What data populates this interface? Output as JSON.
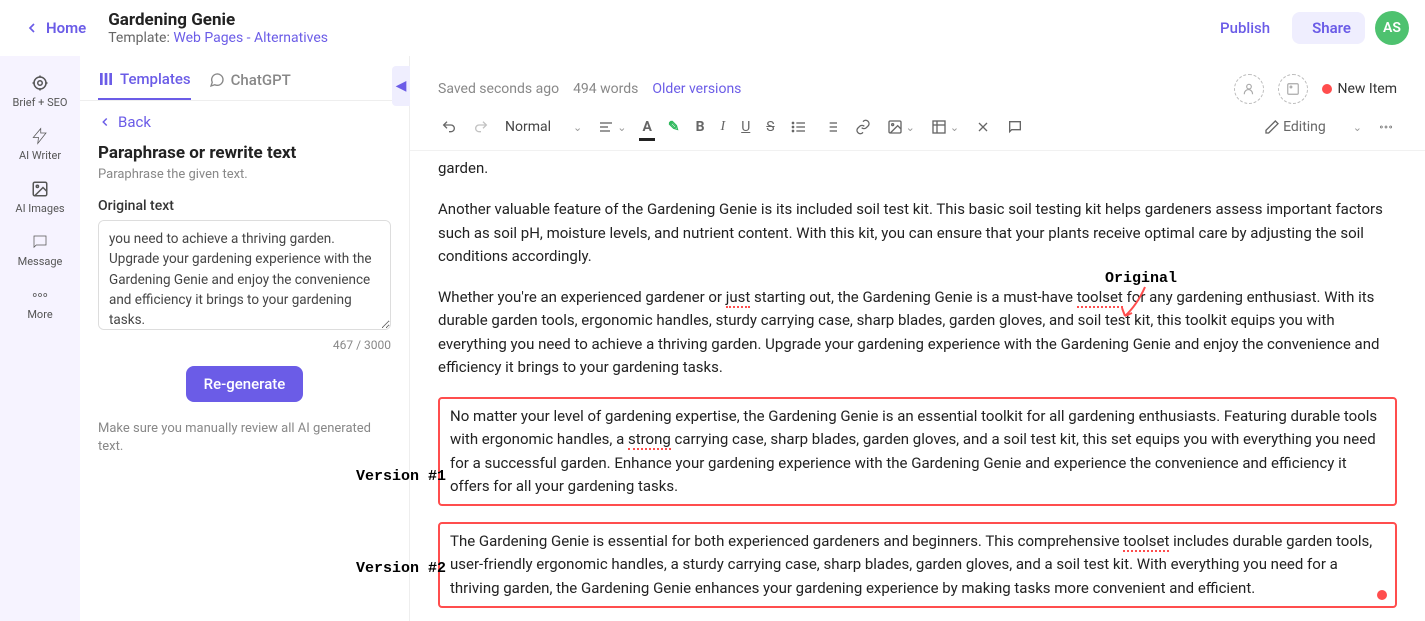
{
  "header": {
    "home": "Home",
    "title": "Gardening Genie",
    "template_prefix": "Template: ",
    "template_name": "Web Pages - Alternatives",
    "publish": "Publish",
    "share": "Share",
    "avatar": "AS"
  },
  "rail": {
    "brief": "Brief + SEO",
    "writer": "AI Writer",
    "images": "AI Images",
    "message": "Message",
    "more": "More"
  },
  "panel": {
    "tab_templates": "Templates",
    "tab_chatgpt": "ChatGPT",
    "back": "Back",
    "title": "Paraphrase or rewrite text",
    "subtitle": "Paraphrase the given text.",
    "original_label": "Original text",
    "original_value": "you need to achieve a thriving garden. Upgrade your gardening experience with the Gardening Genie and enjoy the convenience and efficiency it brings to your gardening tasks.",
    "counter": "467 / 3000",
    "regenerate": "Re-generate",
    "warning": "Make sure you manually review all AI generated text."
  },
  "editor": {
    "saved": "Saved seconds ago",
    "words": "494 words",
    "older": "Older versions",
    "new_item": "New Item",
    "format": "Normal",
    "mode": "Editing"
  },
  "doc": {
    "frag": "garden.",
    "p1": "Another valuable feature of the Gardening Genie is its included soil test kit. This basic soil testing kit helps gardeners assess important factors such as soil pH, moisture levels, and nutrient content. With this kit, you can ensure that your plants receive optimal care by adjusting the soil conditions accordingly.",
    "p2a": "Whether you're an experienced gardener or ",
    "p2_just": "just",
    "p2b": " starting out, the Gardening Genie is a must-have ",
    "p2_toolset": "toolset",
    "p2c": " for any gardening enthusiast. With its durable garden tools, ergonomic handles, sturdy carrying case, sharp blades, garden gloves, and soil test kit, this toolkit equips you with everything you need to achieve a thriving garden. Upgrade your gardening experience with the Gardening Genie and enjoy the convenience and efficiency it brings to your gardening tasks.",
    "v1a": "No matter your level of gardening expertise, the Gardening Genie is an essential toolkit for all gardening enthusiasts. Featuring durable tools with ergonomic handles, a ",
    "v1_strong": "strong",
    "v1b": " carrying case, sharp blades, garden gloves, and a soil test kit, this set equips you with everything you need for a successful garden. Enhance your gardening experience with the Gardening Genie and experience the convenience and efficiency it offers for all your gardening tasks.",
    "v2a": "The Gardening Genie is essential for both experienced gardeners and beginners. This comprehensive ",
    "v2_toolset": "toolset",
    "v2b": " includes durable garden tools, user-friendly ergonomic handles, a sturdy carrying case, sharp blades, garden gloves, and a soil test kit. With everything you need for a thriving garden, the Gardening Genie enhances your gardening experience by making tasks more convenient and efficient."
  },
  "annotations": {
    "original": "Original",
    "v1": "Version #1",
    "v2": "Version #2"
  }
}
